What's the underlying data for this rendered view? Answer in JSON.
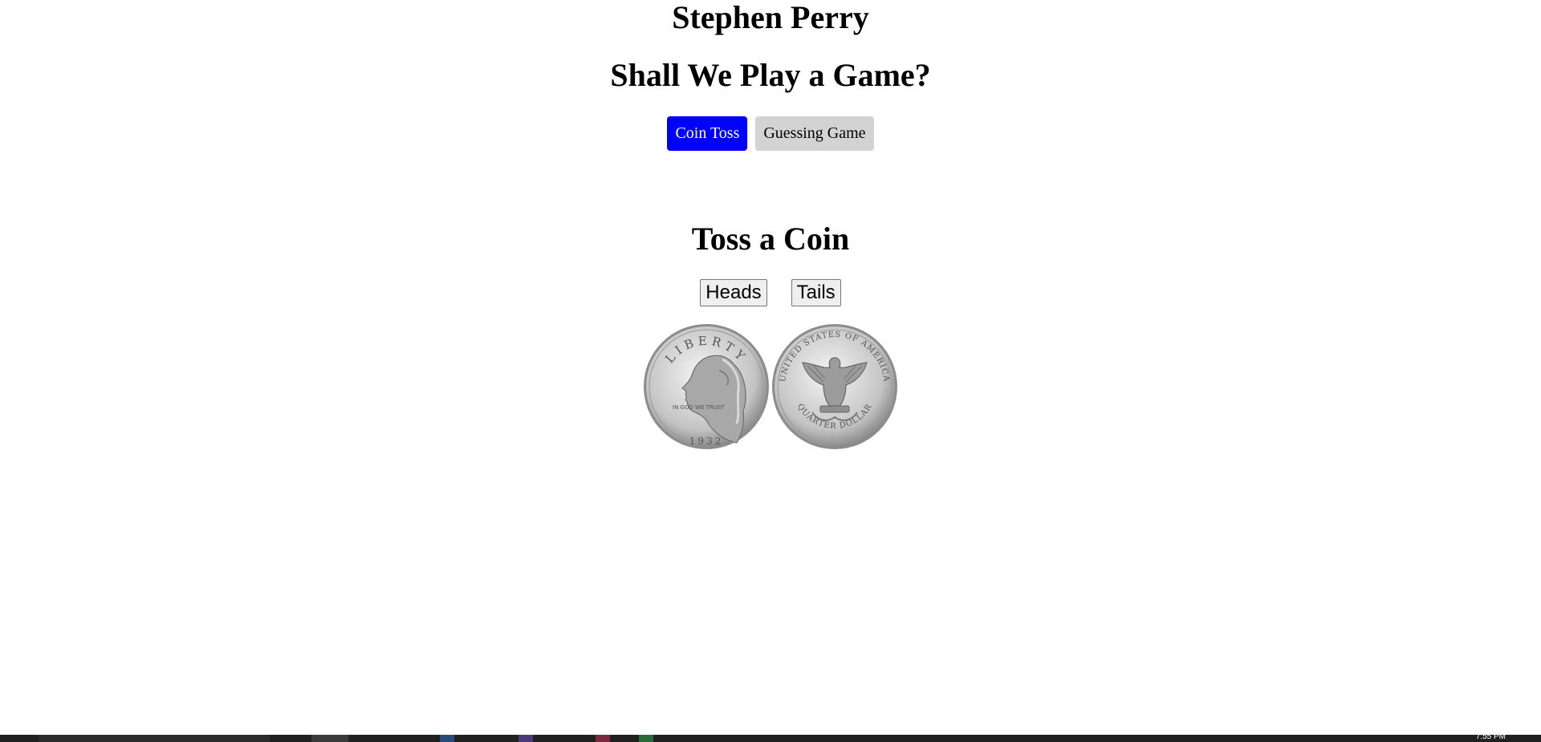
{
  "header": {
    "author": "Stephen Perry",
    "title": "Shall We Play a Game?"
  },
  "tabs": [
    {
      "label": "Coin Toss",
      "active": true
    },
    {
      "label": "Guessing Game",
      "active": false
    }
  ],
  "coin_toss": {
    "heading": "Toss a Coin",
    "heads_label": "Heads",
    "tails_label": "Tails",
    "coin_images": [
      {
        "side": "heads",
        "icon": "quarter-heads-icon",
        "legend_top": "LIBERTY",
        "motto": "IN GOD WE TRUST",
        "year": "1932"
      },
      {
        "side": "tails",
        "icon": "quarter-tails-icon",
        "legend_top": "UNITED STATES OF AMERICA",
        "legend_bottom": "QUARTER DOLLAR"
      }
    ]
  },
  "colors": {
    "active_tab": "#0000ff",
    "inactive_tab": "#d3d3d3",
    "taskbar": "#202020"
  },
  "taskbar": {
    "clock": "7:55 PM"
  }
}
